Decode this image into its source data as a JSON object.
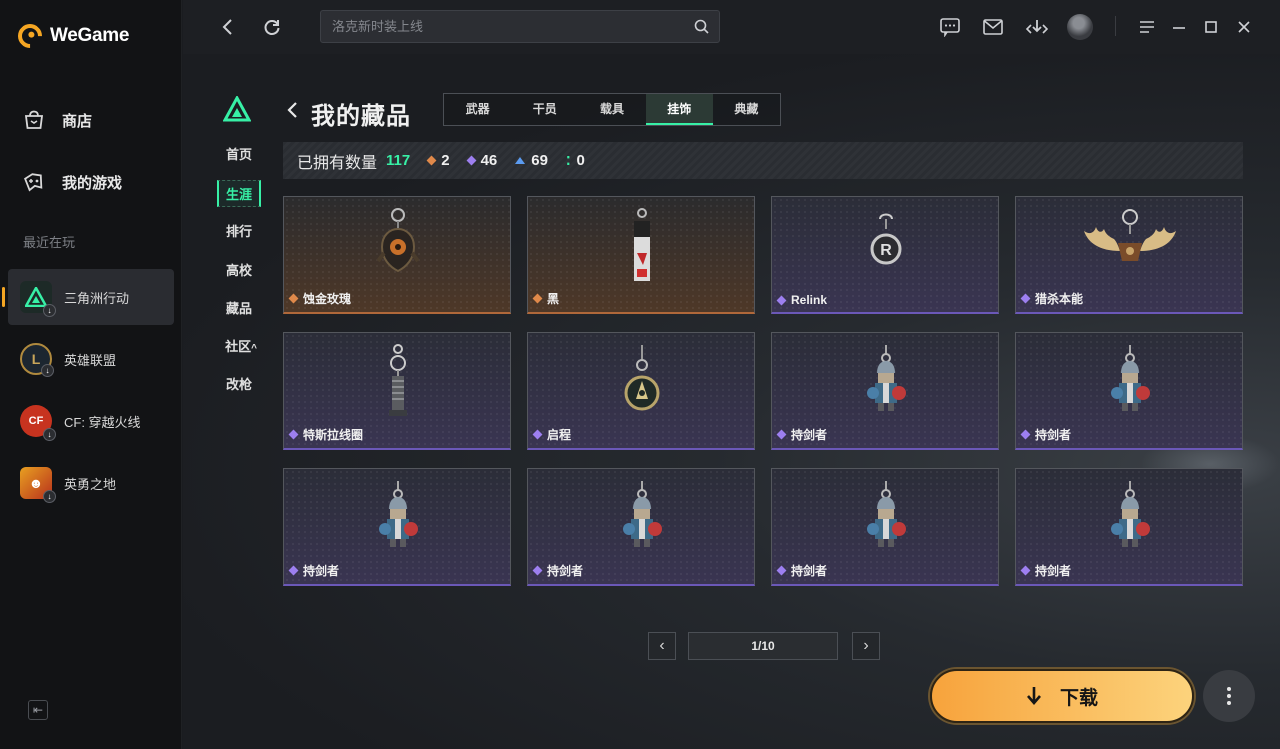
{
  "app": {
    "name": "WeGame"
  },
  "sidebar": {
    "main_nav": [
      {
        "label": "商店",
        "icon": "shop-bag-icon"
      },
      {
        "label": "我的游戏",
        "icon": "gamepad-icon"
      }
    ],
    "recent_title": "最近在玩",
    "recent_games": [
      {
        "label": "三角洲行动",
        "icon": "delta-force-icon",
        "active": true
      },
      {
        "label": "英雄联盟",
        "icon": "league-of-legends-icon",
        "active": false
      },
      {
        "label": "CF: 穿越火线",
        "icon": "crossfire-icon",
        "active": false
      },
      {
        "label": "英勇之地",
        "icon": "brave-land-icon",
        "active": false
      }
    ]
  },
  "topbar": {
    "search_placeholder": "洛克新时装上线",
    "icons": [
      "back-arrow-icon",
      "refresh-icon",
      "search-icon",
      "message-icon",
      "mail-icon",
      "download-manager-icon",
      "user-avatar",
      "menu-icon",
      "minimize-icon",
      "maximize-icon",
      "close-icon"
    ]
  },
  "game_nav": {
    "items": [
      "首页",
      "生涯",
      "排行",
      "高校",
      "藏品",
      "社区",
      "改枪"
    ],
    "active": "生涯",
    "community_arrow": "^"
  },
  "collection": {
    "title": "我的藏品",
    "tabs": [
      {
        "label": "武器",
        "active": false
      },
      {
        "label": "干员",
        "active": false
      },
      {
        "label": "载具",
        "active": false
      },
      {
        "label": "挂饰",
        "active": true
      },
      {
        "label": "典藏",
        "active": false
      }
    ],
    "owned_label": "已拥有数量",
    "owned_count": "117",
    "rarity_counts": [
      {
        "value": "2",
        "color": "#e0894a"
      },
      {
        "value": "46",
        "color": "#9d7ff0"
      },
      {
        "value": "69",
        "color": "#5b9bf0"
      },
      {
        "value": "0",
        "color": "#37f0a6"
      }
    ],
    "items": [
      {
        "name": "蚀金玫瑰",
        "rarity": "orange",
        "art": "golden-rose-charm"
      },
      {
        "name": "黑",
        "rarity": "orange",
        "art": "black-tag-charm"
      },
      {
        "name": "Relink",
        "rarity": "purple",
        "art": "relink-badge-charm"
      },
      {
        "name": "猎杀本能",
        "rarity": "purple",
        "art": "antler-charm"
      },
      {
        "name": "特斯拉线圈",
        "rarity": "purple",
        "art": "tesla-coil-charm"
      },
      {
        "name": "启程",
        "rarity": "purple",
        "art": "compass-medal-charm"
      },
      {
        "name": "持剑者",
        "rarity": "purple",
        "art": "knight-figure-charm"
      },
      {
        "name": "持剑者",
        "rarity": "purple",
        "art": "knight-figure-charm"
      },
      {
        "name": "持剑者",
        "rarity": "purple",
        "art": "knight-figure-charm"
      },
      {
        "name": "持剑者",
        "rarity": "purple",
        "art": "knight-figure-charm"
      },
      {
        "name": "持剑者",
        "rarity": "purple",
        "art": "knight-figure-charm"
      },
      {
        "name": "持剑者",
        "rarity": "purple",
        "art": "knight-figure-charm"
      }
    ]
  },
  "pagination": {
    "indicator": "1/10"
  },
  "actions": {
    "download_label": "下载"
  },
  "colors": {
    "accent_green": "#37f0a6",
    "accent_orange": "#f5a623"
  }
}
